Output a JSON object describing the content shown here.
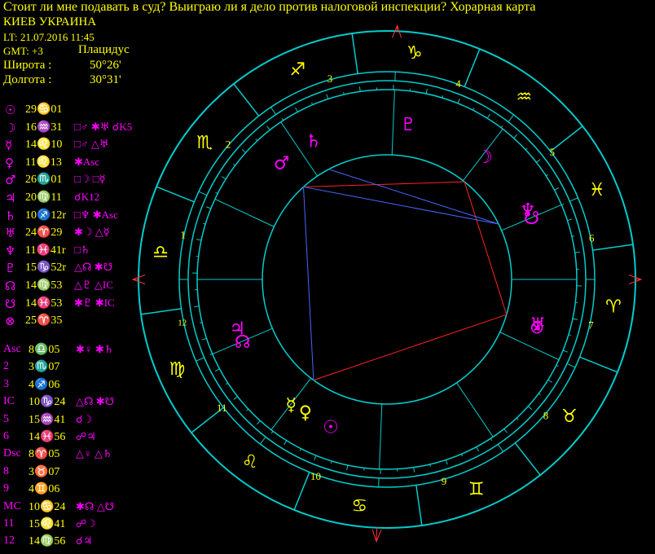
{
  "header": {
    "title": "Стоит ли мне подавать в суд? Выиграю ли я дело против налоговой инспекции? Хорарная карта",
    "place": "КИЕВ УКРАИНА",
    "local_time": "LT: 21.07.2016  11:45",
    "gmt": "GMT: +3",
    "house_system": "Плацидус",
    "latitude_label": "Широта :",
    "latitude_value": "50°26'",
    "longitude_label": "Долгота :",
    "longitude_value": "30°31'"
  },
  "planets": [
    {
      "symbol": "☉",
      "position": "29♋01",
      "aspects": ""
    },
    {
      "symbol": "☽",
      "position": "16♒31",
      "aspects": "□♂ ✱♅ ☌K5"
    },
    {
      "symbol": "☿",
      "position": "14♌10",
      "aspects": "□♂ △♅"
    },
    {
      "symbol": "♀",
      "position": "11♌13",
      "aspects": "✱Asc"
    },
    {
      "symbol": "♂",
      "position": "26♏01",
      "aspects": "□☽ □☿"
    },
    {
      "symbol": "♃",
      "position": "20♍11",
      "aspects": "☌K12"
    },
    {
      "symbol": "♄",
      "position": "10♐12r",
      "aspects": "□♆ ✱Asc"
    },
    {
      "symbol": "♅",
      "position": "24♈29",
      "aspects": "✱☽ △☿"
    },
    {
      "symbol": "♆",
      "position": "11♓41r",
      "aspects": "□♄"
    },
    {
      "symbol": "♇",
      "position": "15♑52r",
      "aspects": "△☊ ✱☋"
    },
    {
      "symbol": "☊",
      "position": "14♍53",
      "aspects": "△♇ △IC"
    },
    {
      "symbol": "☋",
      "position": "14♓53",
      "aspects": "✱♇ ✱IC"
    },
    {
      "symbol": "⊗",
      "position": "25♈35",
      "aspects": ""
    }
  ],
  "houses": [
    {
      "label": "Asc",
      "position": "8♎05",
      "aspects": "✱♀ ✱♄"
    },
    {
      "label": "2",
      "position": "3♏07",
      "aspects": ""
    },
    {
      "label": "3",
      "position": "4♐06",
      "aspects": ""
    },
    {
      "label": "IC",
      "position": "10♑24",
      "aspects": "△☊ ✱☋"
    },
    {
      "label": "5",
      "position": "15♒41",
      "aspects": "☌☽"
    },
    {
      "label": "6",
      "position": "14♓56",
      "aspects": "☍♃"
    },
    {
      "label": "Dsc",
      "position": "8♈05",
      "aspects": "△♀ △♄"
    },
    {
      "label": "8",
      "position": "3♉07",
      "aspects": ""
    },
    {
      "label": "9",
      "position": "4♊06",
      "aspects": ""
    },
    {
      "label": "MC",
      "position": "10♋24",
      "aspects": "✱☊ △☋"
    },
    {
      "label": "11",
      "position": "15♌41",
      "aspects": "☍☽"
    },
    {
      "label": "12",
      "position": "14♍56",
      "aspects": "☌♃"
    }
  ],
  "chart": {
    "asc_longitude": 188.08,
    "signs": [
      "♈",
      "♉",
      "♊",
      "♋",
      "♌",
      "♍",
      "♎",
      "♏",
      "♐",
      "♑",
      "♒",
      "♓"
    ],
    "house_cusps": [
      188.08,
      213.12,
      244.1,
      280.4,
      315.68,
      344.93,
      8.08,
      33.12,
      64.1,
      100.4,
      135.68,
      164.93
    ],
    "house_numbers": [
      "1",
      "2",
      "3",
      "4",
      "5",
      "6",
      "7",
      "8",
      "9",
      "10",
      "11",
      "12"
    ],
    "planets": [
      {
        "glyph": "☉",
        "lon": 119.02,
        "color": "#ff00ff"
      },
      {
        "glyph": "☽",
        "lon": 316.52,
        "color": "#ff00ff"
      },
      {
        "glyph": "☿",
        "lon": 134.17,
        "color": "#ffff00"
      },
      {
        "glyph": "♀",
        "lon": 131.22,
        "color": "#ffff00"
      },
      {
        "glyph": "♂",
        "lon": 236.02,
        "color": "#ff00ff"
      },
      {
        "glyph": "♃",
        "lon": 170.18,
        "color": "#ff00ff"
      },
      {
        "glyph": "♄",
        "lon": 250.2,
        "color": "#ff00ff"
      },
      {
        "glyph": "♅",
        "lon": 24.48,
        "color": "#ff00ff"
      },
      {
        "glyph": "♆",
        "lon": 341.68,
        "color": "#ff00ff"
      },
      {
        "glyph": "♇",
        "lon": 285.87,
        "color": "#ff00ff"
      },
      {
        "glyph": "☊",
        "lon": 164.88,
        "color": "#ff00ff"
      },
      {
        "glyph": "☋",
        "lon": 344.88,
        "color": "#ff00ff"
      },
      {
        "glyph": "⊗",
        "lon": 25.58,
        "color": "#ff00ff"
      }
    ],
    "aspect_lines": [
      {
        "from": 236.02,
        "to": 316.52,
        "color": "#ff2222"
      },
      {
        "from": 134.17,
        "to": 236.02,
        "color": "#4466ff"
      },
      {
        "from": 134.17,
        "to": 24.48,
        "color": "#ff2222"
      },
      {
        "from": 24.48,
        "to": 316.52,
        "color": "#ff2222"
      },
      {
        "from": 250.2,
        "to": 341.68,
        "color": "#4466ff"
      },
      {
        "from": 236.02,
        "to": 341.68,
        "color": "#4466ff"
      }
    ],
    "colors": {
      "ring": "#00cccc",
      "axis": "#ff3333",
      "sign_glyph": "#ffff00",
      "house_number": "#ffff00",
      "planet": "#ff00ff",
      "text": "#ffff00",
      "background": "#000000"
    }
  }
}
